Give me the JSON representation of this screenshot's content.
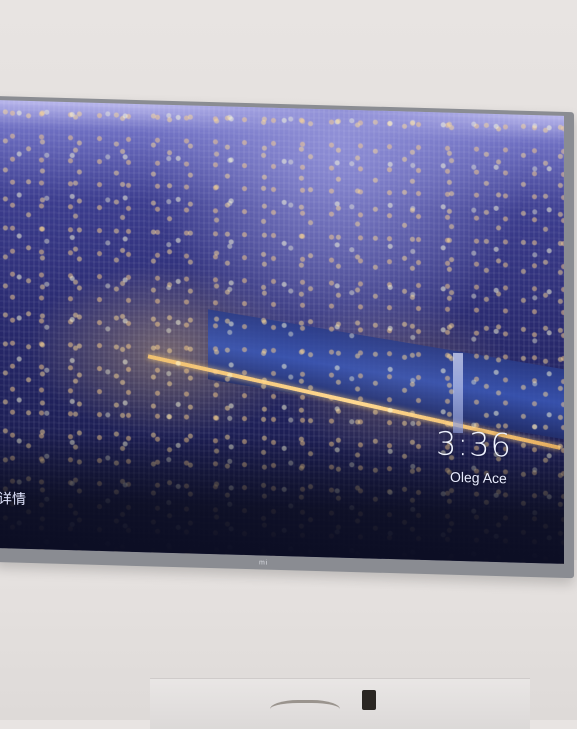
{
  "screen": {
    "time": "3:36",
    "user_name": "Oleg Ace",
    "caption_fragment": "详情",
    "wallpaper_icon": "city-night-wallpaper"
  },
  "tv": {
    "logo_text": "mi",
    "bezel_color": "#8a8c92"
  }
}
